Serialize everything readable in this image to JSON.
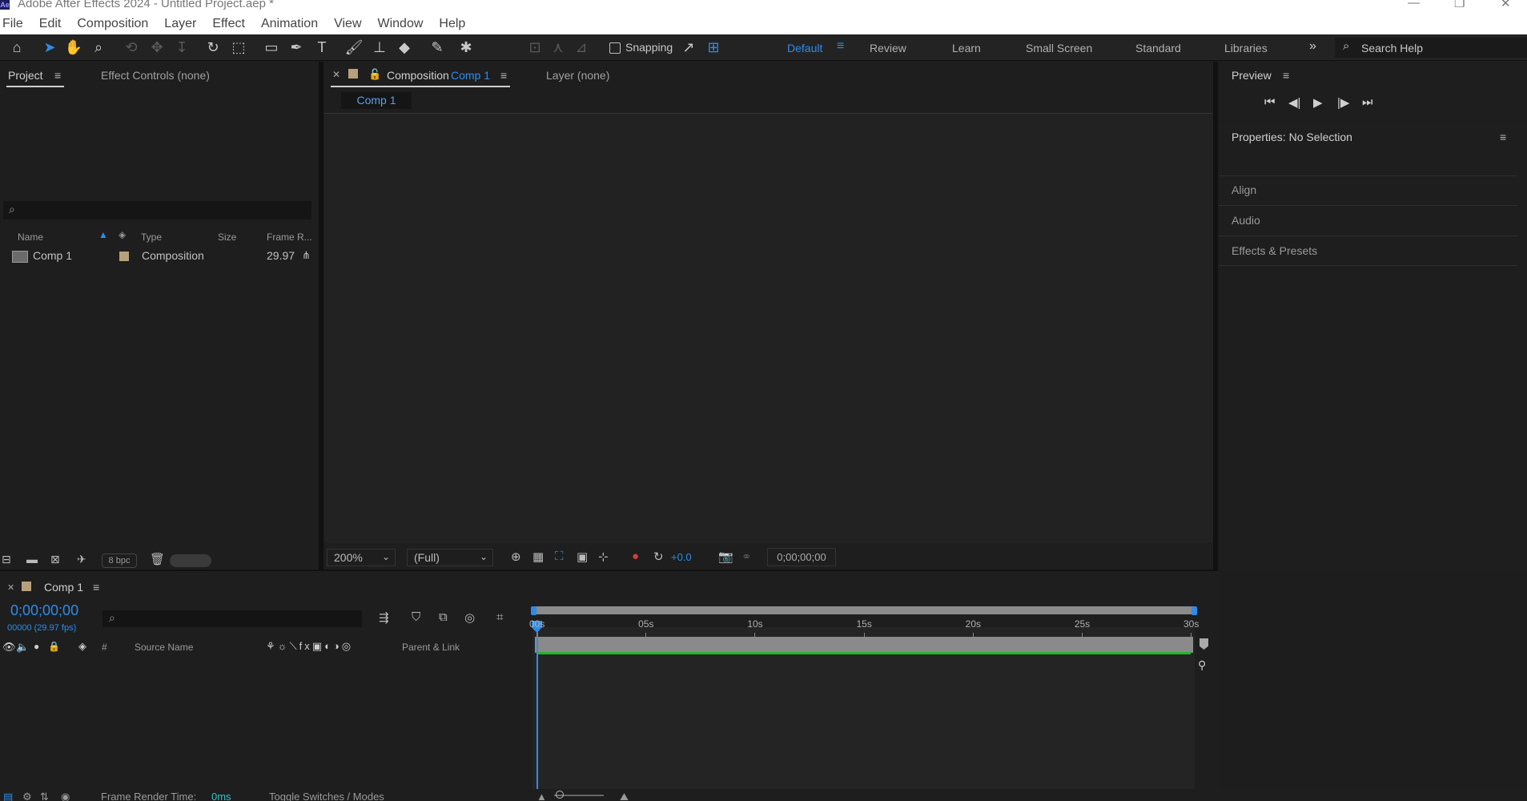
{
  "window": {
    "title": "Adobe After Effects 2024 - Untitled Project.aep *",
    "app_icon": "Ae"
  },
  "menu": [
    "File",
    "Edit",
    "Composition",
    "Layer",
    "Effect",
    "Animation",
    "View",
    "Window",
    "Help"
  ],
  "toolbar": {
    "snapping_label": "Snapping",
    "workspaces": [
      "Default",
      "Review",
      "Learn",
      "Small Screen",
      "Standard",
      "Libraries"
    ],
    "active_workspace": "Default",
    "search_placeholder": "Search Help",
    "accent_color": "#2d8ceb"
  },
  "project_panel": {
    "tab_project": "Project",
    "tab_effect_controls": "Effect Controls (none)",
    "columns": {
      "name": "Name",
      "type": "Type",
      "size": "Size",
      "frame_rate": "Frame R..."
    },
    "items": [
      {
        "name": "Comp 1",
        "type": "Composition",
        "size": "",
        "frame_rate": "29.97"
      }
    ],
    "bpc": "8 bpc"
  },
  "viewer": {
    "tab_prefix": "Composition",
    "tab_comp_name": "Comp 1",
    "layer_tab": "Layer  (none)",
    "comp_chip": "Comp 1",
    "zoom": "200%",
    "resolution": "(Full)",
    "exposure": "+0.0",
    "timecode": "0;00;00;00"
  },
  "right_panel": {
    "preview_title": "Preview",
    "properties_title": "Properties: No Selection",
    "sections": [
      "Align",
      "Audio",
      "Effects & Presets"
    ]
  },
  "timeline": {
    "comp_tab": "Comp 1",
    "current_time": "0;00;00;00",
    "frame_info": "00000 (29.97 fps)",
    "col_number": "#",
    "col_source_name": "Source Name",
    "col_parent": "Parent & Link",
    "ruler_labels": [
      "00s",
      "05s",
      "10s",
      "15s",
      "20s",
      "25s",
      "30s"
    ],
    "duration_seconds": 30,
    "playhead_seconds": 0,
    "footer_render_label": "Frame Render Time:",
    "footer_render_value": "0ms",
    "footer_toggle": "Toggle Switches / Modes",
    "layer_bar_color": "#1fb82a"
  }
}
